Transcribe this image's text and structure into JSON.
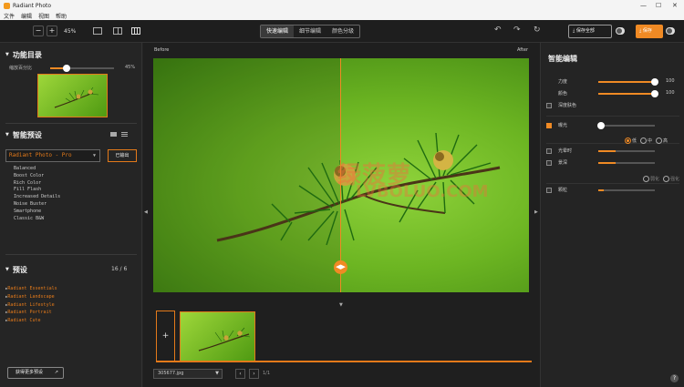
{
  "window": {
    "title": "Radiant Photo",
    "minimize": "—",
    "maximize": "☐",
    "close": "✕"
  },
  "menu": [
    "文件",
    "编辑",
    "视图",
    "帮助"
  ],
  "toolbar": {
    "zoom_out": "−",
    "zoom_in": "+",
    "zoom": "45%",
    "modes": [
      {
        "label": "快速编辑",
        "active": true
      },
      {
        "label": "细节编辑",
        "active": false
      },
      {
        "label": "颜色分级",
        "active": false
      }
    ],
    "undo": "↶",
    "redo": "↷",
    "reset": "↻",
    "save_preset": "保存全部",
    "export": "保存"
  },
  "left": {
    "section1_title": "功能目录",
    "thumb_slider_label": "缩放百分比",
    "thumb_slider_value": "45%",
    "thumb_slider_fraction": 0.25,
    "section2_title": "智能预设",
    "dropdown_value": "Radiant Photo - Pro",
    "apply_button": "已输出",
    "styles": [
      "Balanced",
      "Boost Color",
      "Rich Color",
      "Fill Flash",
      "Increased Details",
      "Noise Buster",
      "Smartphone",
      "Classic B&W"
    ],
    "section3_title": "预设",
    "section3_count": "16 / 6",
    "presets": [
      "Radiant Essentials",
      "Radiant Landscape",
      "Radiant Lifestyle",
      "Radiant Portrait",
      "Radiant Cute"
    ],
    "more_button": "获得更多预设"
  },
  "canvas": {
    "before_label": "Before",
    "after_label": "After",
    "watermark_line1": "绿菠萝",
    "watermark_line2": "LVBOLUO.COM",
    "add_label": "+",
    "file_name": "305677.jpg",
    "prev": "‹",
    "next": "›",
    "page_info": "1/1"
  },
  "right": {
    "title": "智能编辑",
    "sliders": [
      {
        "label": "力度",
        "value": "100",
        "fraction": 1.0,
        "checkbox": false
      },
      {
        "label": "颜色",
        "value": "100",
        "fraction": 1.0,
        "checkbox": false
      },
      {
        "label": "深度肤色",
        "value": "",
        "fraction": null,
        "checkbox": true,
        "checked": false
      },
      {
        "label": "曝光",
        "value": "",
        "fraction": 0.05,
        "checkbox": true,
        "checked": true
      },
      {
        "label": "光晕时",
        "value": "",
        "fraction": 0.3,
        "checkbox": true,
        "checked": false
      },
      {
        "label": "景深",
        "value": "",
        "fraction": 0.3,
        "checkbox": true,
        "checked": false
      },
      {
        "label": "颗粒",
        "value": "",
        "fraction": 0.1,
        "checkbox": true,
        "checked": false
      }
    ],
    "radio_options": [
      "低",
      "中",
      "高"
    ],
    "radio_options2": [
      "弱化",
      "强化"
    ],
    "help": "?"
  },
  "colors": {
    "accent": "#f08a24",
    "panel": "#252525",
    "background": "#1f1f1f"
  }
}
